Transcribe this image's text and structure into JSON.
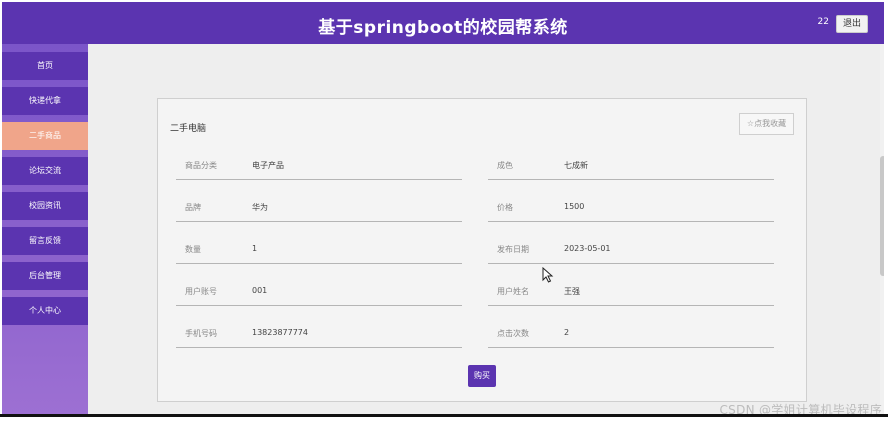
{
  "header": {
    "title": "基于springboot的校园帮系统",
    "user": "22",
    "logout_label": "退出"
  },
  "sidebar": {
    "items": [
      {
        "label": "首页"
      },
      {
        "label": "快递代拿"
      },
      {
        "label": "二手商品",
        "active": true
      },
      {
        "label": "论坛交流"
      },
      {
        "label": "校园资讯"
      },
      {
        "label": "留言反馈"
      },
      {
        "label": "后台管理"
      },
      {
        "label": "个人中心"
      }
    ]
  },
  "product": {
    "name": "二手电脑",
    "favorite_label": "☆点我收藏",
    "fields": [
      {
        "label": "商品分类",
        "value": "电子产品"
      },
      {
        "label": "成色",
        "value": "七成新"
      },
      {
        "label": "品牌",
        "value": "华为"
      },
      {
        "label": "价格",
        "value": "1500"
      },
      {
        "label": "数量",
        "value": "1"
      },
      {
        "label": "发布日期",
        "value": "2023-05-01"
      },
      {
        "label": "用户账号",
        "value": "001"
      },
      {
        "label": "用户姓名",
        "value": "王强"
      },
      {
        "label": "手机号码",
        "value": "13823877774"
      },
      {
        "label": "点击次数",
        "value": "2"
      }
    ],
    "buy_label": "购买"
  },
  "watermark": "CSDN @学姐计算机毕设程序",
  "colors": {
    "primary": "#5b34b0",
    "active_nav": "#f0a58a",
    "background": "#eeeeee"
  }
}
